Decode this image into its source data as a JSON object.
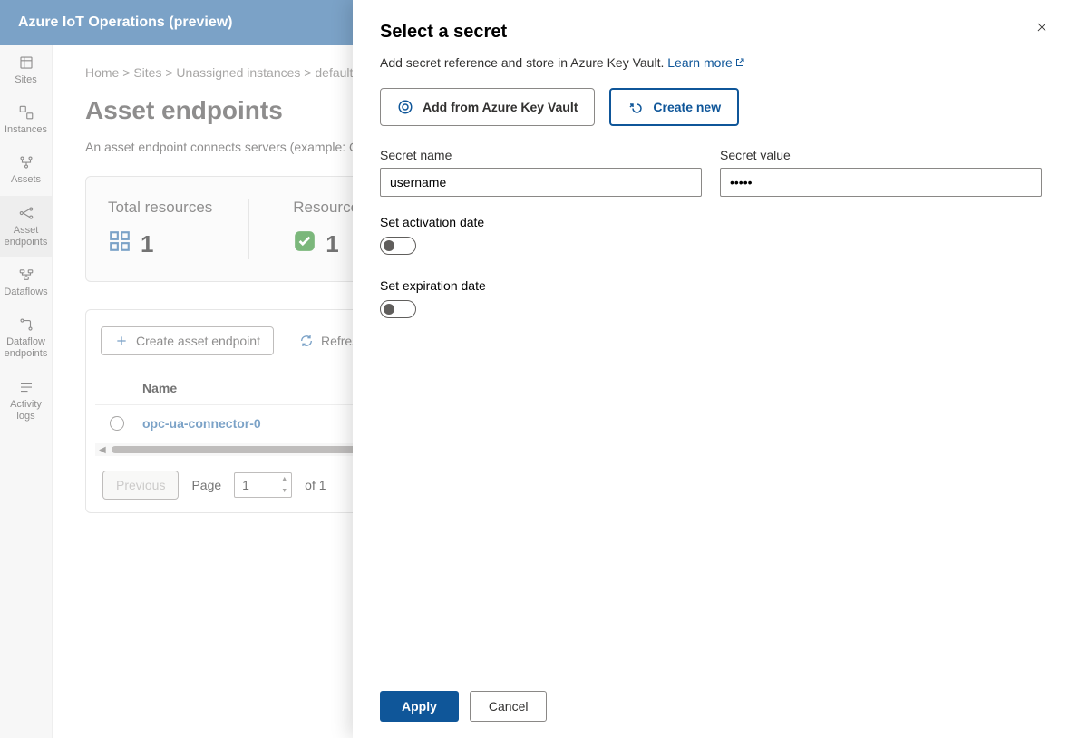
{
  "header": {
    "title": "Azure IoT Operations (preview)"
  },
  "sidenav": {
    "items": [
      {
        "label": "Sites"
      },
      {
        "label": "Instances"
      },
      {
        "label": "Assets"
      },
      {
        "label": "Asset endpoints"
      },
      {
        "label": "Dataflows"
      },
      {
        "label": "Dataflow endpoints"
      },
      {
        "label": "Activity logs"
      }
    ]
  },
  "breadcrumb": {
    "home": "Home",
    "sites": "Sites",
    "unassigned": "Unassigned instances",
    "last": "default"
  },
  "page": {
    "title": "Asset endpoints",
    "description": "An asset endpoint connects servers (example: OPC UA) to your assets."
  },
  "stats": {
    "total_label": "Total resources",
    "total_value": "1",
    "recent_label": "Resources with recent changes",
    "recent_value": "1"
  },
  "toolbar": {
    "create_label": "Create asset endpoint",
    "refresh_label": "Refresh"
  },
  "table": {
    "col_name": "Name",
    "rows": [
      {
        "name": "opc-ua-connector-0"
      }
    ]
  },
  "pager": {
    "previous": "Previous",
    "page_label": "Page",
    "current": "1",
    "of_label": "of 1"
  },
  "panel": {
    "title": "Select a secret",
    "description_pre": "Add secret reference and store in Azure Key Vault. ",
    "learn_more": "Learn more",
    "option_add": "Add from Azure Key Vault",
    "option_create": "Create new",
    "secret_name_label": "Secret name",
    "secret_name_value": "username",
    "secret_value_label": "Secret value",
    "secret_value_value": "•••••",
    "activation_label": "Set activation date",
    "expiration_label": "Set expiration date",
    "apply": "Apply",
    "cancel": "Cancel"
  }
}
